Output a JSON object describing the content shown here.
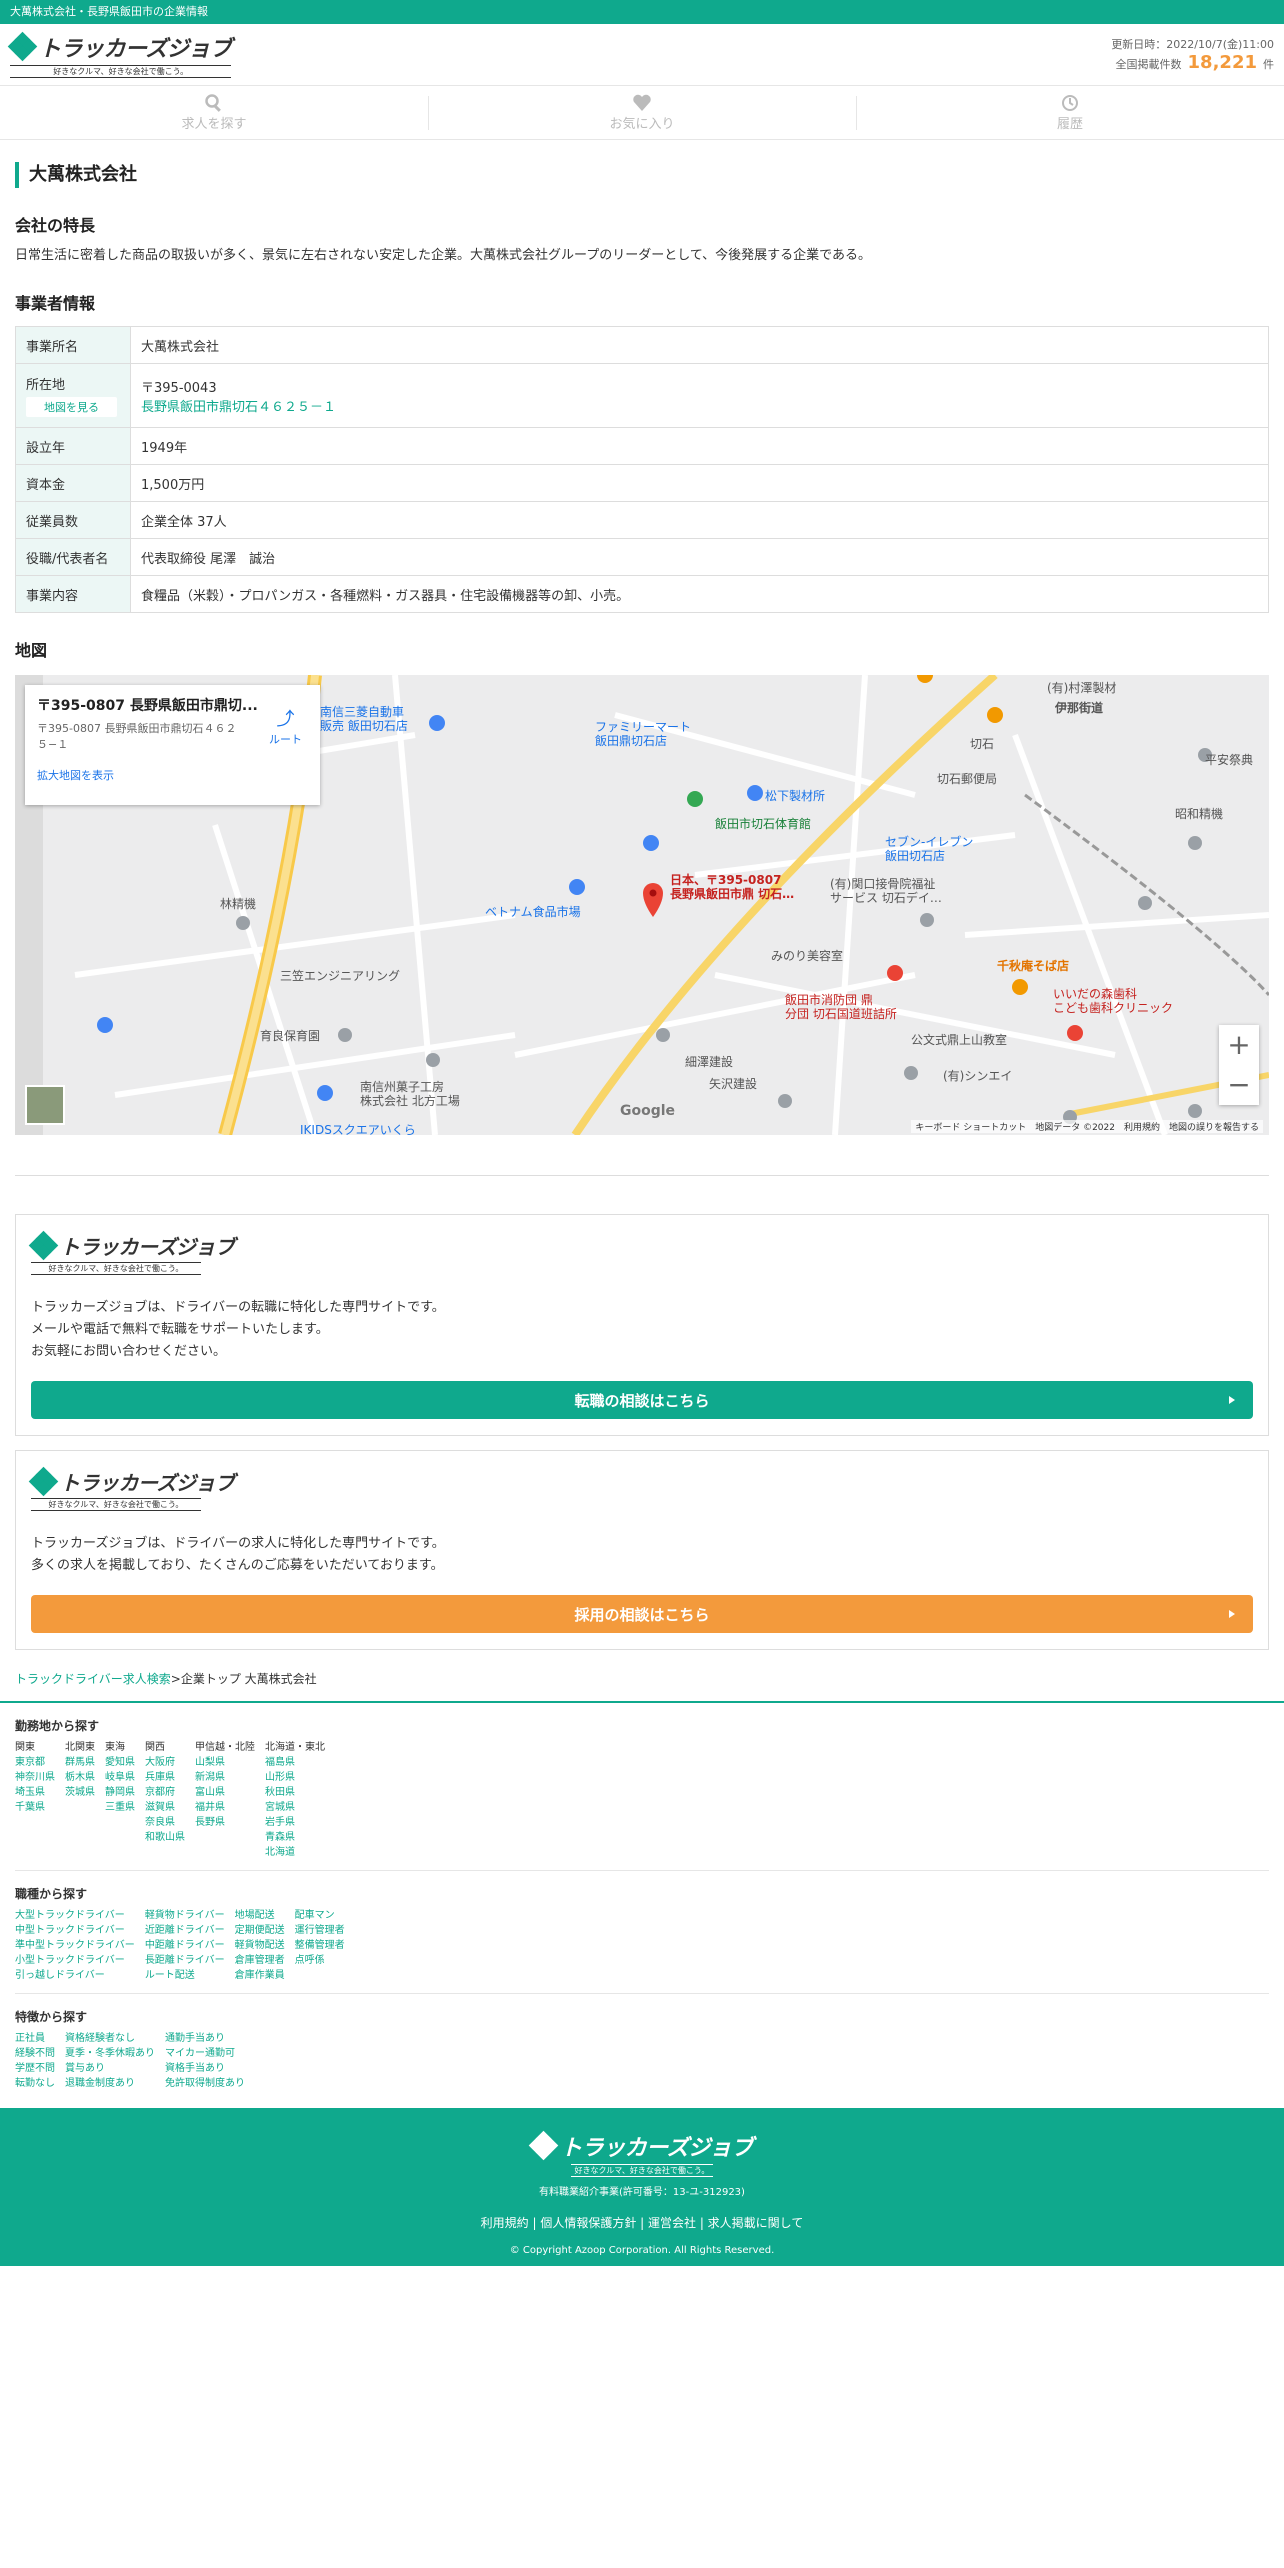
{
  "topbar": {
    "text": "大萬株式会社・長野県飯田市の企業情報"
  },
  "header": {
    "logo_text": "トラッカーズジョブ",
    "logo_tagline": "好きなクルマ、好きな会社で働こう。",
    "updated_label": "更新日時：2022/10/7(金)11:00",
    "total_label": "全国掲載件数",
    "total_count": "18,221",
    "total_unit": "件"
  },
  "nav": {
    "search": "求人を探す",
    "favorite": "お気に入り",
    "history": "履歴"
  },
  "company": {
    "name": "大萬株式会社",
    "features_heading": "会社の特長",
    "features_text": "日常生活に密着した商品の取扱いが多く、景気に左右されない安定した企業。大萬株式会社グループのリーダーとして、今後発展する企業である。",
    "info_heading": "事業者情報",
    "info": {
      "office_label": "事業所名",
      "office_value": "大萬株式会社",
      "address_label": "所在地",
      "map_button": "地図を見る",
      "postal": "〒395-0043",
      "address": "長野県飯田市鼎切石４６２５－１",
      "founded_label": "設立年",
      "founded_value": "1949年",
      "capital_label": "資本金",
      "capital_value": "1,500万円",
      "employees_label": "従業員数",
      "employees_value": "企業全体 37人",
      "rep_label": "役職/代表者名",
      "rep_value": "代表取締役 尾澤　誠治",
      "business_label": "事業内容",
      "business_value": "食糧品（米穀）・プロパンガス・各種燃料・ガス器具・住宅設備機器等の卸、小売。"
    },
    "map_heading": "地図"
  },
  "map": {
    "info_title": "〒395-0807 長野県飯田市鼎切...",
    "info_address": "〒395-0807 長野県飯田市鼎切石４６２５−１",
    "route_label": "ルート",
    "enlarge_label": "拡大地図を表示",
    "marker_label_1": "日本、〒395-0807",
    "marker_label_2": "長野県飯田市鼎 切石…",
    "google": "Google",
    "attribution": "キーボード ショートカット　地図データ ©2022　利用規約　地図の誤りを報告する",
    "places": [
      "ファミリーマート",
      "飯田鼎切石店",
      "南信三菱自動車",
      "販売 飯田切石店",
      "松下製材所",
      "切石郵便局",
      "飯田市切石体育館",
      "セブン-イレブン",
      "飯田切石店",
      "ベトナム食品市場",
      "林精機",
      "三笠エンジニアリング",
      "みのり美容室",
      "千秋庵そば店",
      "いいだの森歯科",
      "こども歯科クリニック",
      "飯田市消防団 鼎",
      "分団 切石国道班詰所",
      "公文式鼎上山教室",
      "細澤建設",
      "矢沢建設",
      "(有)シンエイ",
      "南信州菓子工房",
      "株式会社 北方工場",
      "育良保育園",
      "昭和精機",
      "平安祭典",
      "(有)村澤製材",
      "伊那街道",
      "切石",
      "IKIDSスクエアいくら",
      "(有)関口接骨院福祉",
      "サービス 切石デイ…"
    ]
  },
  "cta1": {
    "text1": "トラッカーズジョブは、ドライバーの転職に特化した専門サイトです。",
    "text2": "メールや電話で無料で転職をサポートいたします。",
    "text3": "お気軽にお問い合わせください。",
    "button": "転職の相談はこちら"
  },
  "cta2": {
    "text1": "トラッカーズジョブは、ドライバーの求人に特化した専門サイトです。",
    "text2": "多くの求人を掲載しており、たくさんのご応募をいただいております。",
    "button": "採用の相談はこちら"
  },
  "breadcrumb": {
    "link": "トラックドライバー求人検索",
    "sep": ">",
    "current": "企業トップ 大萬株式会社"
  },
  "footer_search": {
    "area_heading": "勤務地から探す",
    "area_cols": [
      {
        "h": "関東",
        "items": [
          "東京都",
          "神奈川県",
          "埼玉県",
          "千葉県"
        ]
      },
      {
        "h": "北関東",
        "items": [
          "群馬県",
          "栃木県",
          "茨城県"
        ]
      },
      {
        "h": "東海",
        "items": [
          "愛知県",
          "岐阜県",
          "静岡県",
          "三重県"
        ]
      },
      {
        "h": "関西",
        "items": [
          "大阪府",
          "兵庫県",
          "京都府",
          "滋賀県",
          "奈良県",
          "和歌山県"
        ]
      },
      {
        "h": "甲信越・北陸",
        "items": [
          "山梨県",
          "新潟県",
          "富山県",
          "福井県",
          "長野県"
        ]
      },
      {
        "h": "北海道・東北",
        "items": [
          "福島県",
          "山形県",
          "秋田県",
          "宮城県",
          "岩手県",
          "青森県",
          "北海道"
        ]
      }
    ],
    "job_heading": "職種から探す",
    "job_cols": [
      {
        "items": [
          "大型トラックドライバー",
          "中型トラックドライバー",
          "準中型トラックドライバー",
          "小型トラックドライバー",
          "引っ越しドライバー"
        ]
      },
      {
        "items": [
          "軽貨物ドライバー",
          "近距離ドライバー",
          "中距離ドライバー",
          "長距離ドライバー",
          "ルート配送"
        ]
      },
      {
        "items": [
          "地場配送",
          "定期便配送",
          "軽貨物配送",
          "倉庫管理者",
          "倉庫作業員"
        ]
      },
      {
        "items": [
          "配車マン",
          "運行管理者",
          "整備管理者",
          "点呼係"
        ]
      }
    ],
    "feature_heading": "特徴から探す",
    "feature_cols": [
      {
        "items": [
          "正社員",
          "経験不問",
          "学歴不問",
          "転勤なし"
        ]
      },
      {
        "items": [
          "資格経験者なし",
          "夏季・冬季休暇あり",
          "賞与あり",
          "退職金制度あり"
        ]
      },
      {
        "items": [
          "通勤手当あり",
          "マイカー通勤可",
          "資格手当あり",
          "免許取得制度あり"
        ]
      }
    ]
  },
  "footer": {
    "logo_text": "トラッカーズジョブ",
    "logo_tagline": "好きなクルマ、好きな会社で働こう。",
    "license": "有料職業紹介事業(許可番号：13-ユ-312923)",
    "links": "利用規約 | 個人情報保護方針 | 運営会社 | 求人掲載に関して",
    "copyright": "© Copyright Azoop Corporation. All Rights Reserved."
  }
}
